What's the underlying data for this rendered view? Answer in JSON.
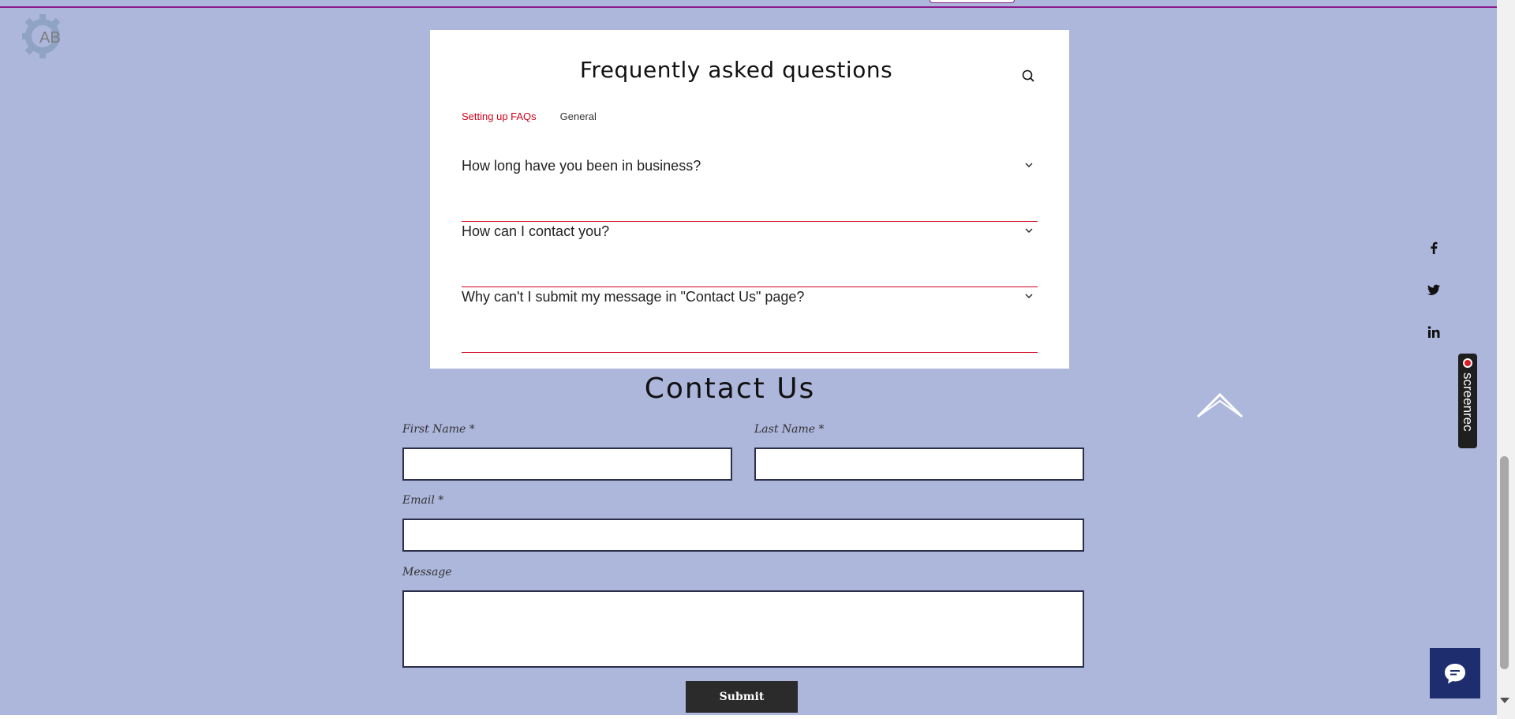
{
  "colors": {
    "page_bg": "#ADB6DB",
    "accent_red": "#D0021B",
    "field_border": "#2B2F4A",
    "submit_bg": "#2B2B2B",
    "chat_bg": "#1E2D6E",
    "top_line": "#8A1A8E"
  },
  "logo": {
    "text": "AB",
    "icon": "gear-logo-icon"
  },
  "faq": {
    "title": "Frequently asked questions",
    "search_icon": "search-icon",
    "tabs": [
      {
        "label": "Setting up FAQs",
        "active": true
      },
      {
        "label": "General",
        "active": false
      }
    ],
    "items": [
      {
        "question": "How long have you been in business?"
      },
      {
        "question": "How can I contact you?"
      },
      {
        "question": "Why can't I submit my message in \"Contact Us\" page?"
      }
    ]
  },
  "contact": {
    "title": "Contact Us",
    "first_name_label": "First Name *",
    "last_name_label": "Last Name *",
    "email_label": "Email *",
    "message_label": "Message",
    "first_name_value": "",
    "last_name_value": "",
    "email_value": "",
    "message_value": "",
    "submit_label": "Submit"
  },
  "social": [
    "facebook-icon",
    "twitter-icon",
    "linkedin-icon"
  ],
  "screenrec": {
    "label": "screenrec"
  },
  "chat": {
    "icon": "chat-icon"
  }
}
